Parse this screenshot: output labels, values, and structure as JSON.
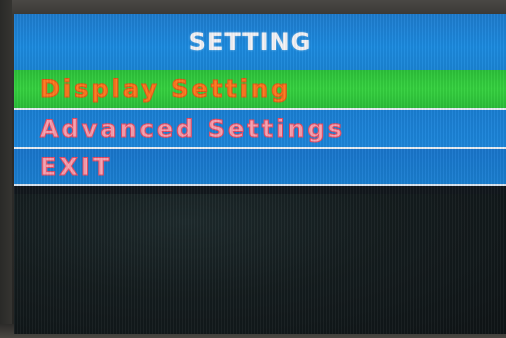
{
  "menu": {
    "title": "SETTING",
    "items": [
      {
        "label": "Display Setting",
        "selected": true
      },
      {
        "label": "Advanced Settings",
        "selected": false
      },
      {
        "label": "EXIT",
        "selected": false
      }
    ]
  },
  "colors": {
    "title_bar": "#1b8be0",
    "selected_bg": "#35d23f",
    "item_bg": "#1c86db",
    "selected_text": "#ff7a20",
    "item_text": "#e84a64",
    "title_text": "#f4f4f8"
  }
}
